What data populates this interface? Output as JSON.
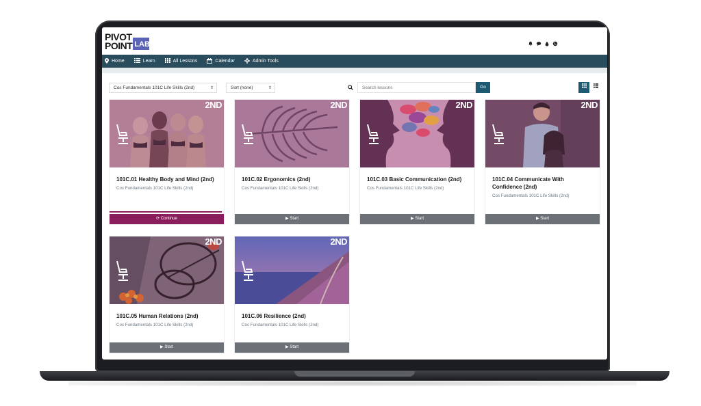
{
  "header": {
    "logo_line1": "PIVOT",
    "logo_line2": "POINT",
    "logo_lab": "LAB",
    "icons": [
      "bell-icon",
      "chat-icon",
      "drop-icon",
      "globe-icon"
    ]
  },
  "nav": {
    "items": [
      {
        "label": "Home",
        "icon": "map-marker-icon"
      },
      {
        "label": "Learn",
        "icon": "list-icon"
      },
      {
        "label": "All Lessons",
        "icon": "grid-icon"
      },
      {
        "label": "Calendar",
        "icon": "calendar-icon"
      },
      {
        "label": "Admin Tools",
        "icon": "gear-icon"
      }
    ]
  },
  "toolbar": {
    "course_select": "Cos Fundamentals 101C Life Skills (2nd)",
    "sort_select": "Sort (none)",
    "search_placeholder": "Search lessons",
    "go_label": "Go"
  },
  "colors": {
    "nav_bg": "#2a4d5e",
    "accent": "#1e5a72",
    "continue_btn": "#8a1d5b",
    "start_btn": "#6b7176",
    "image_tint": "#7a3e6a"
  },
  "lessons": [
    {
      "title": "101C.01 Healthy Body and Mind (2nd)",
      "course": "Cos Fundamentals 101C Life Skills (2nd)",
      "badge": "2ND",
      "button": "Continue",
      "button_icon": "refresh-icon",
      "progress": 0.98
    },
    {
      "title": "101C.02 Ergonomics (2nd)",
      "course": "Cos Fundamentals 101C Life Skills (2nd)",
      "badge": "2ND",
      "button": "Start",
      "button_icon": "play-icon"
    },
    {
      "title": "101C.03 Basic Communication (2nd)",
      "course": "Cos Fundamentals 101C Life Skills (2nd)",
      "badge": "2ND",
      "button": "Start",
      "button_icon": "play-icon"
    },
    {
      "title": "101C.04 Communicate With Confidence (2nd)",
      "course": "Cos Fundamentals 101C Life Skills (2nd)",
      "badge": "2ND",
      "button": "Start",
      "button_icon": "play-icon"
    },
    {
      "title": "101C.05 Human Relations (2nd)",
      "course": "Cos Fundamentals 101C Life Skills (2nd)",
      "badge": "2ND",
      "button": "Start",
      "button_icon": "play-icon"
    },
    {
      "title": "101C.06 Resilience (2nd)",
      "course": "Cos Fundamentals 101C Life Skills (2nd)",
      "badge": "2ND",
      "button": "Start",
      "button_icon": "play-icon"
    }
  ]
}
